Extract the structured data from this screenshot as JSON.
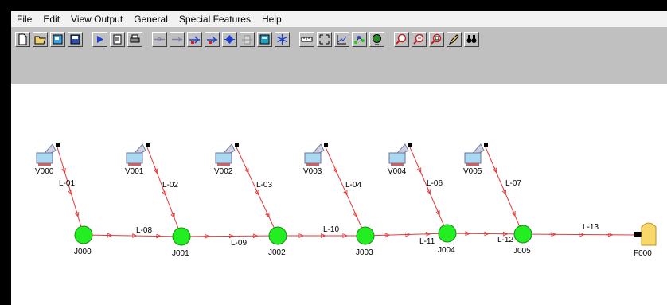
{
  "menu": [
    "File",
    "Edit",
    "View Output",
    "General",
    "Special Features",
    "Help"
  ],
  "toolbar": [
    "new-file-icon",
    "open-folder-icon",
    "open-project-icon",
    "save-icon",
    "sep",
    "run-icon",
    "report-icon",
    "print-icon",
    "sep",
    "add-pipe-icon",
    "add-link-icon",
    "add-pump-icon",
    "add-valve-icon",
    "add-junction-icon",
    "add-tank-icon",
    "calculator-icon",
    "snowflake-icon",
    "sep",
    "ruler-icon",
    "zoom-extents-icon",
    "graph-icon",
    "network-icon",
    "globe-icon",
    "sep",
    "zoom-in-icon",
    "zoom-out-icon",
    "zoom-window-icon",
    "edit-pencil-icon",
    "find-icon"
  ],
  "colors": {
    "pipe": "#e23a3a",
    "junction": "#22ee22",
    "toolbar_bg": "#c0c0c0",
    "tank": "#f9d86b"
  },
  "network": {
    "reservoirs": [
      "V000",
      "V001",
      "V002",
      "V003",
      "V004",
      "V005"
    ],
    "junctions": [
      "J000",
      "J001",
      "J002",
      "J003",
      "J004",
      "J005"
    ],
    "feed": "F000",
    "supply_pipes": [
      "L-01",
      "L-02",
      "L-03",
      "L-04",
      "L-06",
      "L-07"
    ],
    "main_pipes": [
      "L-08",
      "L-09",
      "L-10",
      "L-11",
      "L-12",
      "L-13"
    ]
  }
}
